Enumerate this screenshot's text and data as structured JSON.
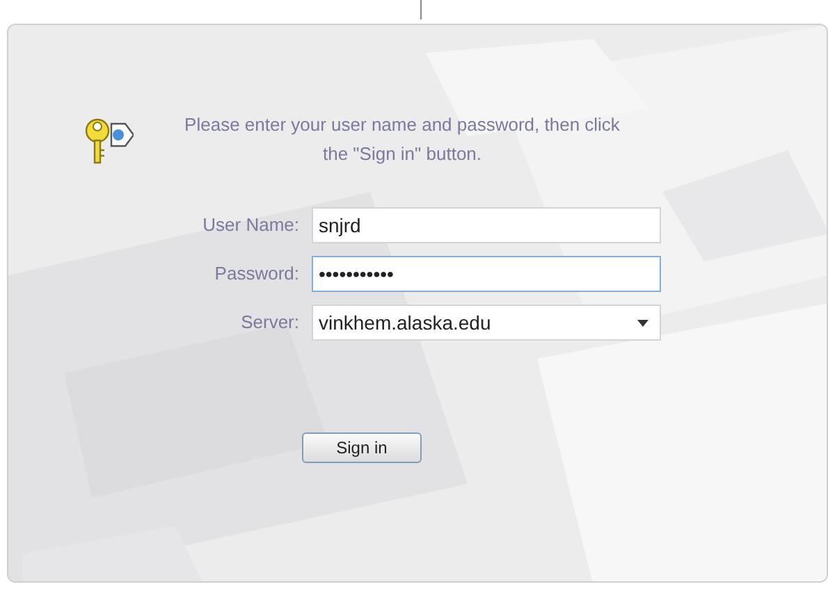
{
  "message": "Please enter your user name and password, then click the \"Sign in\" button.",
  "fields": [
    {
      "kind": "text",
      "label": "User Name:",
      "value": "snjrd",
      "focused": false
    },
    {
      "kind": "text",
      "label": "Password:",
      "value": "•••••••••••",
      "focused": true
    },
    {
      "kind": "dropdown",
      "label": "Server:",
      "value": "vinkhem.alaska.edu",
      "focused": false
    }
  ],
  "sign_in_button": "Sign in"
}
